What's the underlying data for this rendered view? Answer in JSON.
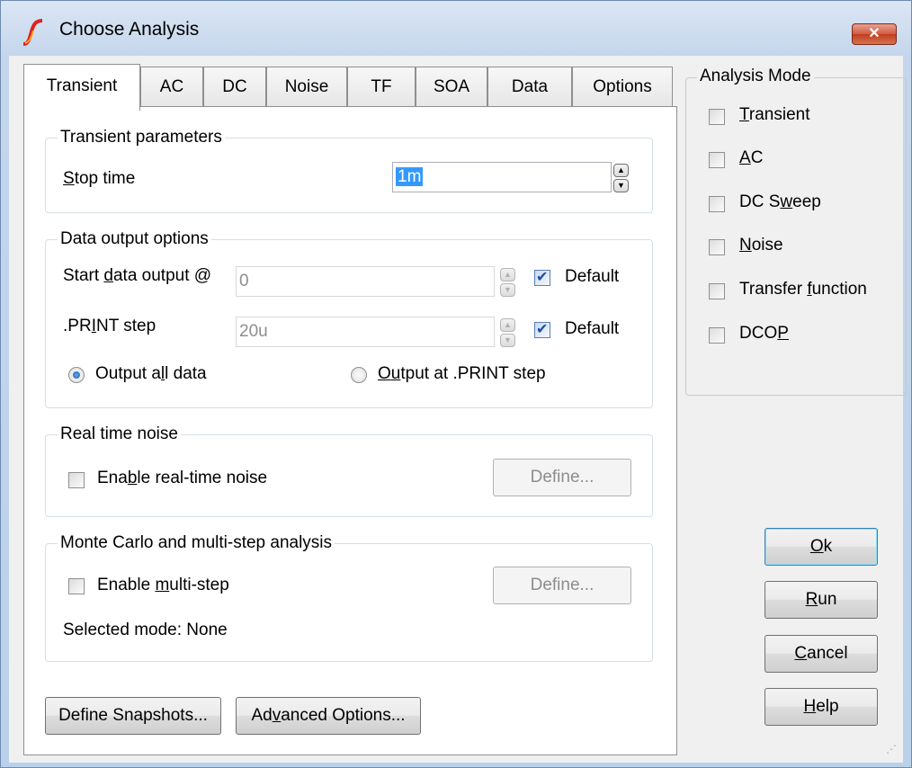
{
  "window": {
    "title": "Choose Analysis",
    "close_label": "✕"
  },
  "tabs": [
    {
      "label": "Transient",
      "active": true
    },
    {
      "label": "AC"
    },
    {
      "label": "DC"
    },
    {
      "label": "Noise"
    },
    {
      "label": "TF"
    },
    {
      "label": "SOA"
    },
    {
      "label": "Data"
    },
    {
      "label": "Options"
    }
  ],
  "transient_params": {
    "legend": "Transient parameters",
    "stop_time_label_u": "S",
    "stop_time_label_rest": "top time",
    "stop_time_value": "1m"
  },
  "data_output": {
    "legend": "Data output options",
    "start_label_pre": "Start ",
    "start_label_u": "d",
    "start_label_post": "ata output @",
    "start_value": "0",
    "print_label_pre": ".PR",
    "print_label_u": "I",
    "print_label_post": "NT step",
    "print_value": "20u",
    "default_label": "Default",
    "output_all_pre": "Output a",
    "output_all_u": "l",
    "output_all_post": "l data",
    "output_print_u": "O",
    "output_print_u2": "u",
    "output_print_post": "tput at .PRINT step"
  },
  "realtime_noise": {
    "legend": "Real time noise",
    "enable_pre": "Ena",
    "enable_u": "b",
    "enable_post": "le real-time noise",
    "define_label": "Define..."
  },
  "monte_carlo": {
    "legend": "Monte Carlo and multi-step analysis",
    "enable_pre": "Enable ",
    "enable_u": "m",
    "enable_post": "ulti-step",
    "define_label": "Define...",
    "selected_mode": "Selected mode: None"
  },
  "bottom_buttons": {
    "snapshots": "Define Snapshots...",
    "advanced_pre": "Ad",
    "advanced_u": "v",
    "advanced_post": "anced Options..."
  },
  "analysis_mode": {
    "legend": "Analysis Mode",
    "items": [
      {
        "u": "T",
        "rest": "ransient",
        "pre": ""
      },
      {
        "u": "A",
        "rest": "C",
        "pre": ""
      },
      {
        "pre": "DC S",
        "u": "w",
        "rest": "eep"
      },
      {
        "pre": "",
        "u": "N",
        "rest": "oise"
      },
      {
        "pre": "Transfer ",
        "u": "f",
        "rest": "unction"
      },
      {
        "pre": "DCO",
        "u": "P",
        "rest": ""
      }
    ]
  },
  "side_buttons": {
    "ok_u": "O",
    "ok_rest": "k",
    "run_u": "R",
    "run_rest": "un",
    "cancel_u": "C",
    "cancel_rest": "ancel",
    "help_u": "H",
    "help_rest": "elp"
  },
  "colors": {
    "accent": "#3399ff",
    "title_bar": "#c5d6ec",
    "close": "#c23c1f"
  }
}
